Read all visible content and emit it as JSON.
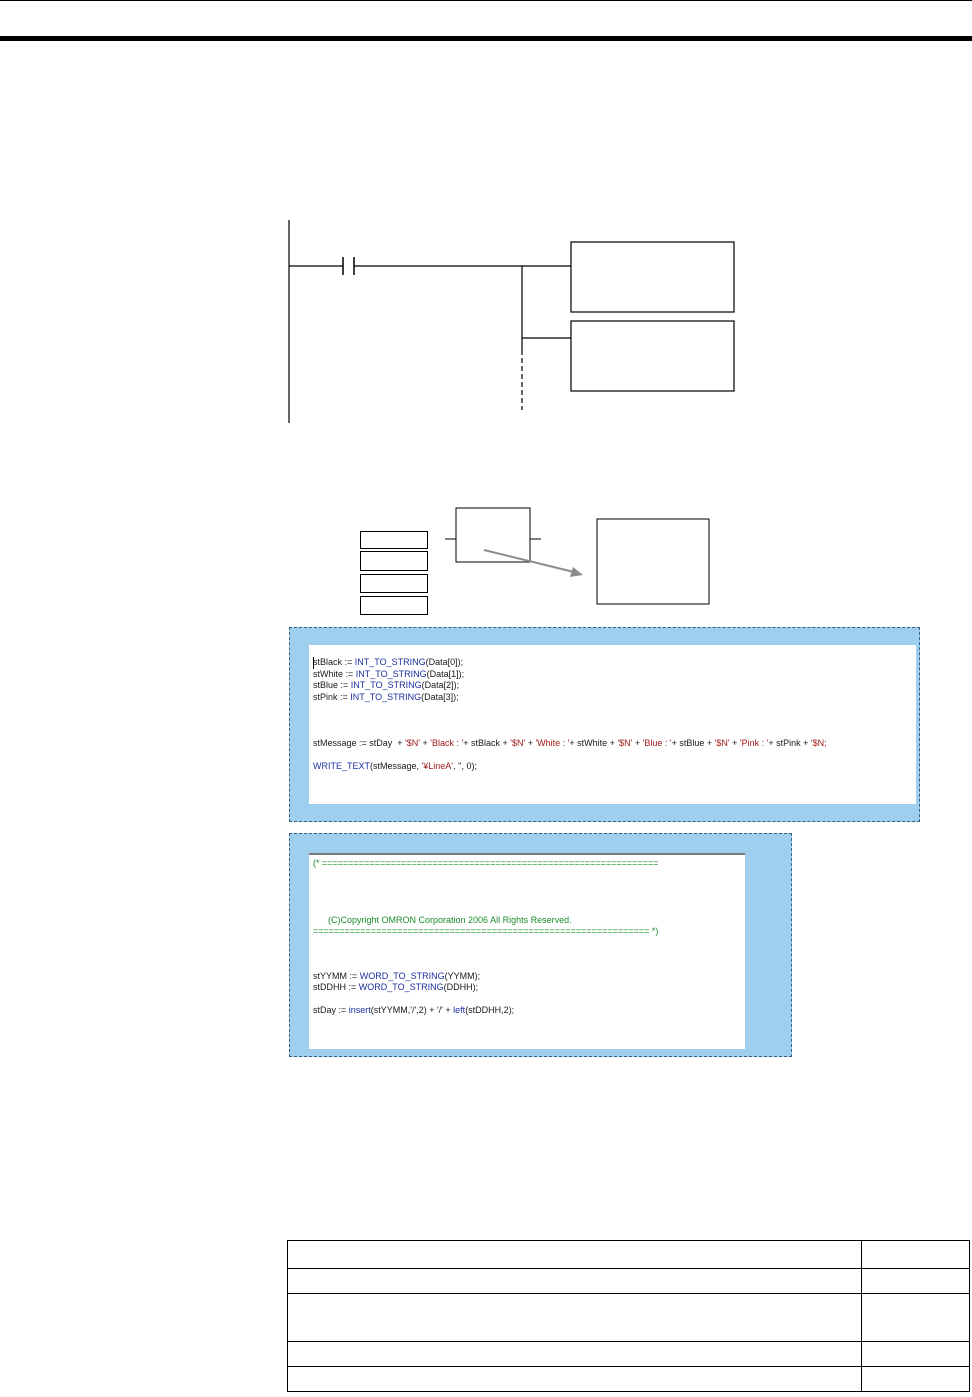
{
  "code_top": {
    "lines": [
      [
        {
          "t": "stBlack := "
        },
        {
          "t": "INT_TO_STRING",
          "c": "kw"
        },
        {
          "t": "(Data[0]);"
        }
      ],
      [
        {
          "t": "stWhite := "
        },
        {
          "t": "INT_TO_STRING",
          "c": "kw"
        },
        {
          "t": "(Data[1]);"
        }
      ],
      [
        {
          "t": "stBlue := "
        },
        {
          "t": "INT_TO_STRING",
          "c": "kw"
        },
        {
          "t": "(Data[2]);"
        }
      ],
      [
        {
          "t": "stPink := "
        },
        {
          "t": "INT_TO_STRING",
          "c": "kw"
        },
        {
          "t": "(Data[3]);"
        }
      ],
      [],
      [],
      [],
      [
        {
          "t": "stMessage := stDay  + "
        },
        {
          "t": "'$N'",
          "c": "str"
        },
        {
          "t": " + "
        },
        {
          "t": "'Black : '",
          "c": "str"
        },
        {
          "t": "+ stBlack + "
        },
        {
          "t": "'$N'",
          "c": "str"
        },
        {
          "t": " + "
        },
        {
          "t": "'White : '",
          "c": "str"
        },
        {
          "t": "+ stWhite + "
        },
        {
          "t": "'$N'",
          "c": "str"
        },
        {
          "t": " + "
        },
        {
          "t": "'Blue : '",
          "c": "str"
        },
        {
          "t": "+ stBlue + "
        },
        {
          "t": "'$N'",
          "c": "str"
        },
        {
          "t": " + "
        },
        {
          "t": "'Pink : '",
          "c": "str"
        },
        {
          "t": "+ stPink + "
        },
        {
          "t": "'$N;",
          "c": "str"
        }
      ],
      [],
      [
        {
          "t": "WRITE_TEXT",
          "c": "kw"
        },
        {
          "t": "(stMessage, "
        },
        {
          "t": "'¥LineA'",
          "c": "str"
        },
        {
          "t": ", '', 0);"
        }
      ]
    ]
  },
  "code_bottom": {
    "lines": [
      [
        {
          "t": "(* ================================================================",
          "c": "cm"
        }
      ],
      [],
      [],
      [],
      [],
      [
        {
          "t": "      (C)Copyright OMRON Corporation 2006 All Rights Reserved.",
          "c": "cm"
        }
      ],
      [
        {
          "t": "================================================================ *)",
          "c": "cm"
        }
      ],
      [],
      [],
      [],
      [
        {
          "t": "stYYMM := "
        },
        {
          "t": "WORD_TO_STRING",
          "c": "kw"
        },
        {
          "t": "(YYMM);"
        }
      ],
      [
        {
          "t": "stDDHH := "
        },
        {
          "t": "WORD_TO_STRING",
          "c": "kw"
        },
        {
          "t": "(DDHH);"
        }
      ],
      [],
      [
        {
          "t": "stDay := "
        },
        {
          "t": "insert",
          "c": "kw"
        },
        {
          "t": "(stYYMM,'/',2) + '/' + "
        },
        {
          "t": "left",
          "c": "kw"
        },
        {
          "t": "(stDDHH,2);"
        }
      ]
    ]
  },
  "colors": {
    "frame_bg": "#9ecfee",
    "keyword": "#1b2fa0",
    "string": "#a01a1a",
    "comment": "#1c8c2c"
  }
}
